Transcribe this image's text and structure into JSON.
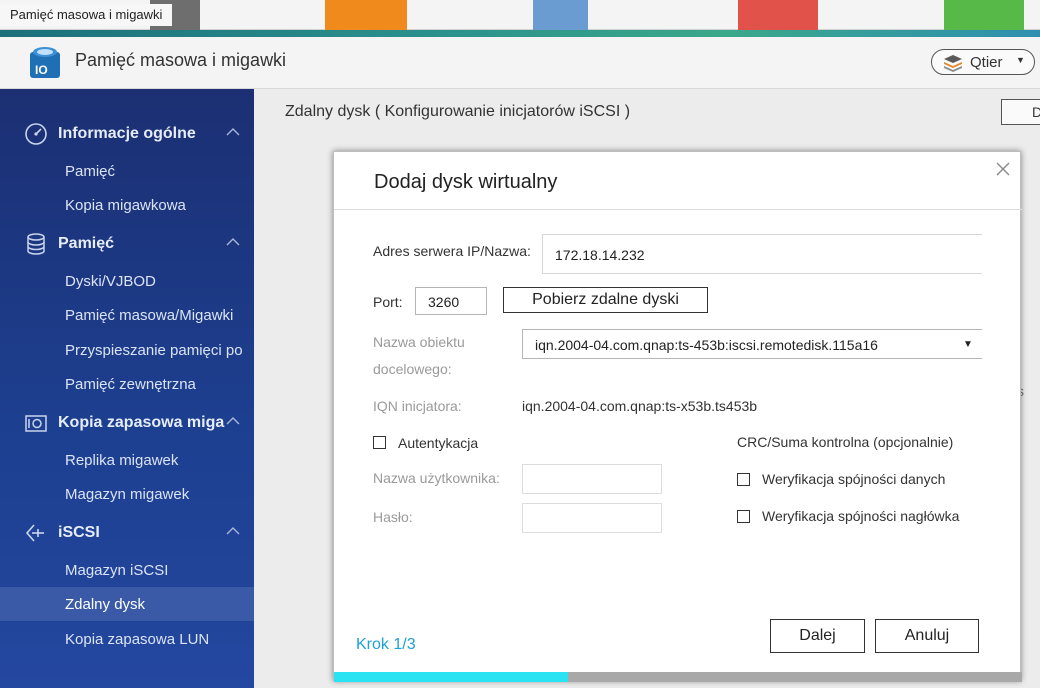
{
  "window": {
    "title": "Pamięć masowa i migawki"
  },
  "header": {
    "app_title": "Pamięć masowa i migawki",
    "qtier_label": "Qtier"
  },
  "sidebar": {
    "sections": [
      {
        "label": "Informacje ogólne",
        "items": [
          "Pamięć",
          "Kopia migawkowa"
        ]
      },
      {
        "label": "Pamięć",
        "items": [
          "Dyski/VJBOD",
          "Pamięć masowa/Migawki",
          "Przyspieszanie pamięci po",
          "Pamięć zewnętrzna"
        ]
      },
      {
        "label": "Kopia zapasowa miga",
        "items": [
          "Replika migawek",
          "Magazyn migawek"
        ]
      },
      {
        "label": "iSCSI",
        "items": [
          "Magazyn iSCSI",
          "Zdalny dysk",
          "Kopia zapasowa LUN"
        ]
      }
    ],
    "active_item": "Zdalny dysk"
  },
  "main": {
    "title": "Zdalny dysk ( Konfigurowanie inicjatorów iSCSI )",
    "button_partial": "D",
    "stray_text": "s"
  },
  "dialog": {
    "title": "Dodaj dysk wirtualny",
    "server_label": "Adres serwera IP/Nazwa:",
    "server_value": "172.18.14.232",
    "port_label": "Port:",
    "port_value": "3260",
    "fetch_button": "Pobierz zdalne dyski",
    "target_label_line1": "Nazwa obiektu",
    "target_label_line2": "docelowego:",
    "target_value": "iqn.2004-04.com.qnap:ts-453b:iscsi.remotedisk.115a16",
    "iqn_label": "IQN inicjatora:",
    "iqn_value": "iqn.2004-04.com.qnap:ts-x53b.ts453b",
    "auth_label": "Autentykacja",
    "auth_checked": false,
    "username_label": "Nazwa użytkownika:",
    "username_value": "",
    "password_label": "Hasło:",
    "password_value": "",
    "crc_heading": "CRC/Suma kontrolna (opcjonalnie)",
    "data_digest_label": "Weryfikacja spójności danych",
    "data_digest_checked": false,
    "header_digest_label": "Weryfikacja spójności nagłówka",
    "header_digest_checked": false,
    "step_label": "Krok 1/3",
    "progress": 0.34,
    "next_button": "Dalej",
    "cancel_button": "Anuluj"
  },
  "colors": {
    "sidebar_top": "#1c2f73",
    "sidebar_active": "#3a5aa8",
    "step_text": "#1fa0d6",
    "progress_fill": "#2ae3f2",
    "progress_track": "#a8a8a8"
  }
}
